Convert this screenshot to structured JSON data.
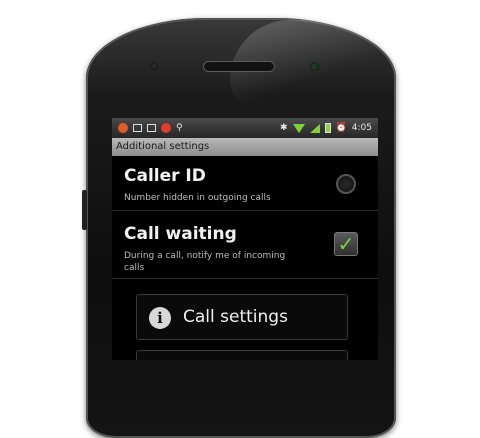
{
  "statusbar": {
    "time": "4:05"
  },
  "screen_title": "Additional settings",
  "caller_id": {
    "title": "Caller ID",
    "summary": "Number hidden in outgoing calls"
  },
  "call_waiting": {
    "title": "Call waiting",
    "summary": "During a call, notify me of incoming calls",
    "checked": true
  },
  "dialog_button": {
    "label": "Call settings",
    "icon": "info-icon"
  },
  "colors": {
    "accent": "#7cd33a",
    "status_icon_red": "#e23b2a",
    "title_bar": "#a9a9a9"
  }
}
